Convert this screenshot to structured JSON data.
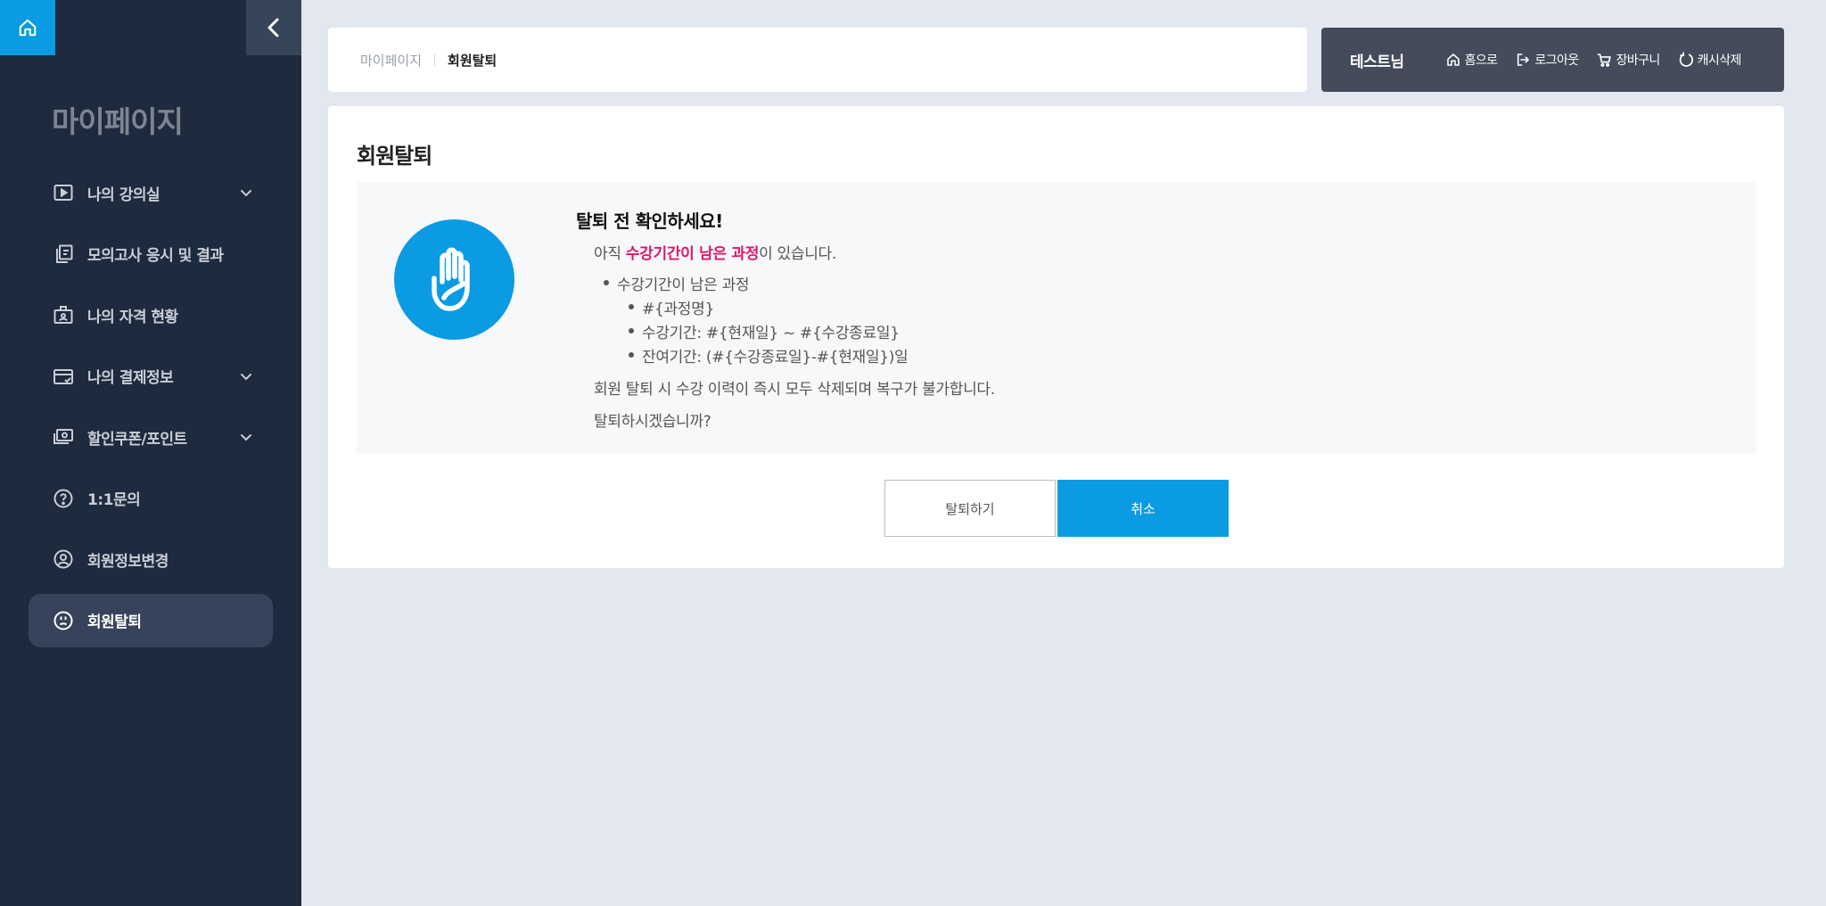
{
  "sidebar": {
    "home_icon": "home-icon",
    "collapse_icon": "chevron-left-icon",
    "title": "마이페이지",
    "items": [
      {
        "label": "나의 강의실",
        "icon": "play-video-icon",
        "has_submenu": true,
        "active": false
      },
      {
        "label": "모의고사 응시 및 결과",
        "icon": "copy-document-icon",
        "has_submenu": false,
        "active": false
      },
      {
        "label": "나의 자격 현황",
        "icon": "id-badge-icon",
        "has_submenu": false,
        "active": false
      },
      {
        "label": "나의 결제정보",
        "icon": "credit-card-icon",
        "has_submenu": true,
        "active": false
      },
      {
        "label": "할인쿠폰/포인트",
        "icon": "money-icon",
        "has_submenu": true,
        "active": false
      },
      {
        "label": "1:1문의",
        "icon": "question-icon",
        "has_submenu": false,
        "active": false
      },
      {
        "label": "회원정보변경",
        "icon": "user-circle-icon",
        "has_submenu": false,
        "active": false
      },
      {
        "label": "회원탈퇴",
        "icon": "sad-face-icon",
        "has_submenu": false,
        "active": true
      }
    ]
  },
  "breadcrumb": {
    "parent": "마이페이지",
    "current": "회원탈퇴"
  },
  "userbar": {
    "user_name": "테스트님",
    "links": [
      {
        "label": "홈으로",
        "icon": "home-icon"
      },
      {
        "label": "로그아웃",
        "icon": "logout-icon"
      },
      {
        "label": "장바구니",
        "icon": "cart-icon"
      },
      {
        "label": "캐시삭제",
        "icon": "refresh-icon"
      }
    ]
  },
  "main": {
    "title": "회원탈퇴",
    "notice": {
      "icon": "stop-hand-icon",
      "heading": "탈퇴 전 확인하세요!",
      "line1_prefix": "아직 ",
      "line1_highlight": "수강기간이 남은 과정",
      "line1_suffix": "이 있습니다.",
      "bullet": "수강기간이 남은 과정",
      "sub_bullets": [
        "#{과정명}",
        "수강기간: #{현재일} ~ #{수강종료일}",
        "잔여기간: (#{수강종료일}-#{현재일})일"
      ],
      "warning": "회원 탈퇴 시 수강 이력이 즉시 모두 삭제되며 복구가 불가합니다.",
      "question": "탈퇴하시겠습니까?"
    },
    "buttons": {
      "leave": "탈퇴하기",
      "cancel": "취소"
    }
  },
  "colors": {
    "sidebar_bg": "#1e2a3e",
    "accent": "#0b9be3",
    "highlight": "#e0166b",
    "userbar_bg": "#444c5b",
    "page_bg": "#e3e7ef"
  }
}
